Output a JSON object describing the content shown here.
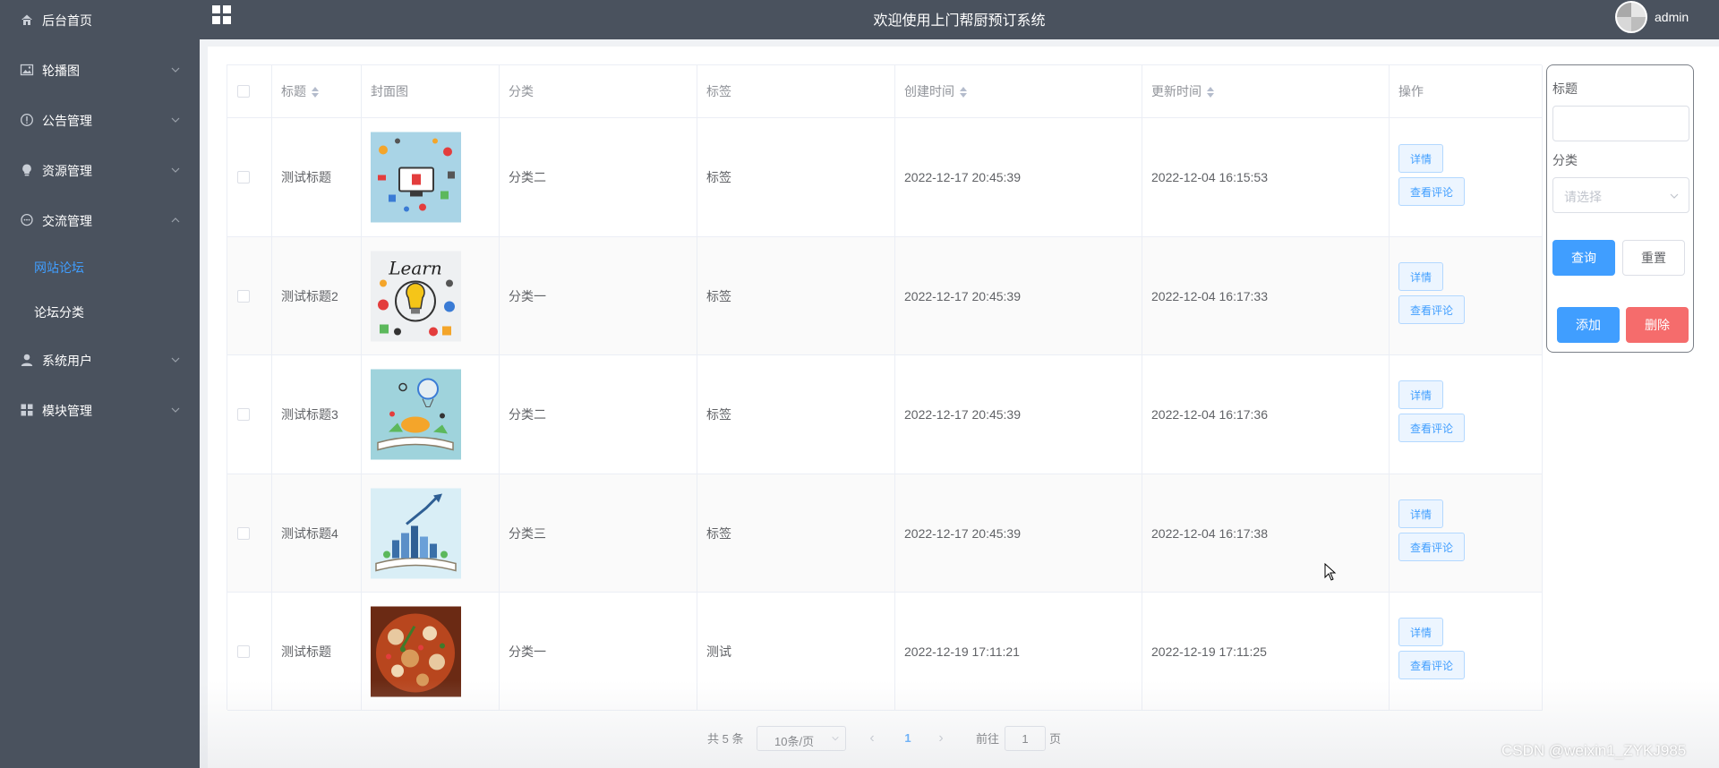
{
  "sidebar": {
    "items": [
      {
        "label": "后台首页",
        "icon": "home-icon"
      },
      {
        "label": "轮播图",
        "icon": "picture-icon"
      },
      {
        "label": "公告管理",
        "icon": "info-icon"
      },
      {
        "label": "资源管理",
        "icon": "bulb-icon"
      },
      {
        "label": "交流管理",
        "icon": "chat-icon"
      },
      {
        "label": "系统用户",
        "icon": "user-icon"
      },
      {
        "label": "模块管理",
        "icon": "grid-icon"
      }
    ],
    "submenu": [
      {
        "label": "网站论坛",
        "active": true
      },
      {
        "label": "论坛分类",
        "active": false
      }
    ]
  },
  "header": {
    "title": "欢迎使用上门帮厨预订系统",
    "username": "admin"
  },
  "table": {
    "columns": [
      "标题",
      "封面图",
      "分类",
      "标签",
      "创建时间",
      "更新时间",
      "操作"
    ],
    "rows": [
      {
        "title": "测试标题",
        "category": "分类二",
        "tag": "标签",
        "created": "2022-12-17 20:45:39",
        "updated": "2022-12-04 16:15:53",
        "cover": "tech-collage"
      },
      {
        "title": "测试标题2",
        "category": "分类一",
        "tag": "标签",
        "created": "2022-12-17 20:45:39",
        "updated": "2022-12-04 16:17:33",
        "cover": "learn-bulb"
      },
      {
        "title": "测试标题3",
        "category": "分类二",
        "tag": "标签",
        "created": "2022-12-17 20:45:39",
        "updated": "2022-12-04 16:17:36",
        "cover": "book-balloon"
      },
      {
        "title": "测试标题4",
        "category": "分类三",
        "tag": "标签",
        "created": "2022-12-17 20:45:39",
        "updated": "2022-12-04 16:17:38",
        "cover": "book-city"
      },
      {
        "title": "测试标题",
        "category": "分类一",
        "tag": "测试",
        "created": "2022-12-19 17:11:21",
        "updated": "2022-12-19 17:11:25",
        "cover": "food-dish"
      }
    ],
    "actions": {
      "detail": "详情",
      "comments": "查看评论"
    }
  },
  "filter": {
    "title_label": "标题",
    "title_value": "",
    "category_label": "分类",
    "category_placeholder": "请选择",
    "query": "查询",
    "reset": "重置",
    "add": "添加",
    "delete": "删除"
  },
  "pagination": {
    "total": "共 5 条",
    "page_size": "10条/页",
    "current_page": "1",
    "goto_label": "前往",
    "goto_value": "1",
    "goto_unit": "页"
  },
  "watermark": "CSDN @weixin1_ZYKJ985",
  "colors": {
    "sidebar_bg": "#4a525e",
    "primary": "#409eff",
    "danger": "#f56c6c"
  }
}
